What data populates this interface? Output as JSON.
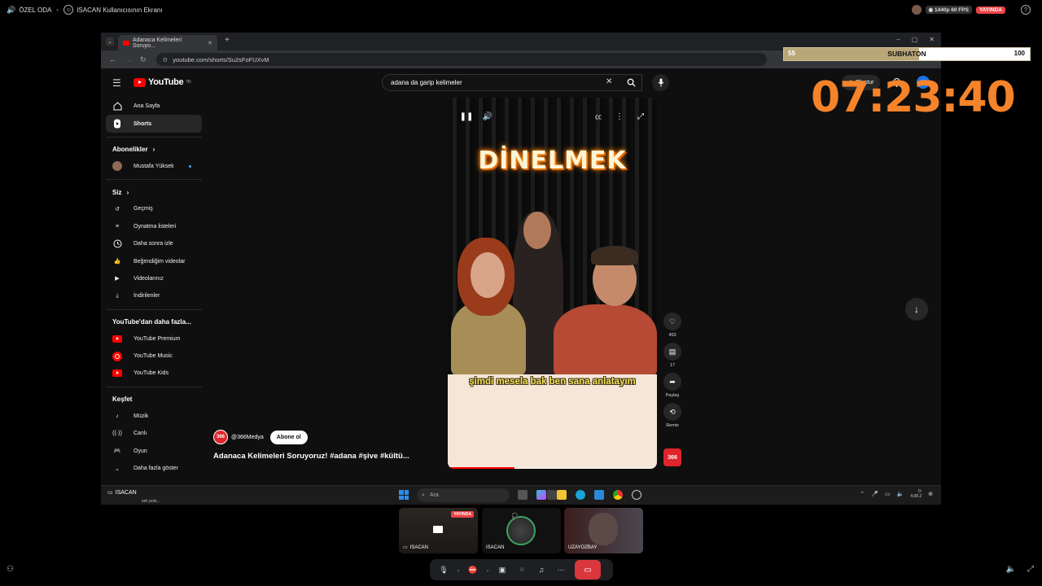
{
  "discord": {
    "server_name": "ÖZEL ODA",
    "stream_title": "ISACAN Kullanıcısının Ekranı",
    "quality": "1440p 60 FPS",
    "live_badge": "YAYINDA"
  },
  "browser": {
    "tab_title": "Adanaca Kelimeleri Soruyo...",
    "url": "youtube.com/shorts/Su2sFoFUXvM"
  },
  "youtube": {
    "logo_text": "YouTube",
    "logo_region": "TR",
    "search_value": "adana da garip kelimeler",
    "create_label": "Oluştur",
    "avatar_letter": "H",
    "sidebar": {
      "home": "Ana Sayfa",
      "shorts": "Shorts",
      "subscriptions_header": "Abonelikler",
      "subscription_1": "Mustafa Yüksek",
      "you_header": "Siz",
      "history": "Geçmiş",
      "playlists": "Oynatma listeleri",
      "watch_later": "Daha sonra izle",
      "liked": "Beğendiğim videolar",
      "your_videos": "Videolarınız",
      "downloads": "İndirilenler",
      "more_header": "YouTube'dan daha fazla...",
      "premium": "YouTube Premium",
      "music": "YouTube Music",
      "kids": "YouTube Kids",
      "explore_header": "Keşfet",
      "explore_music": "Müzik",
      "explore_live": "Canlı",
      "explore_gaming": "Oyun",
      "show_more": "Daha fazla göster"
    },
    "short": {
      "overlay_title": "DİNELMEK",
      "caption": "şimdi mesela bak ben sana anlatayım",
      "progress": 0.32,
      "likes": "453",
      "comments": "17",
      "share_label": "Paylaş",
      "remix_label": "Remix",
      "channel": "@366Medya",
      "channel_logo": "366",
      "subscribe_label": "Abone ol",
      "title": "Adanaca Kelimeleri Soruyoruz! #adana #şive #kültü..."
    }
  },
  "taskbar": {
    "search_placeholder": "Ara",
    "overlay_user": "ISACAN",
    "overlay_sub": "sek pole...",
    "clock_time": "0:",
    "clock_date": "4.08.2"
  },
  "subathon": {
    "left_value": "55",
    "label": "SUBHATON",
    "right_value": "100",
    "progress": 0.55,
    "timer": "07:23:40"
  },
  "participants": [
    {
      "name": "ISACAN",
      "live": "YAYINDA"
    },
    {
      "name": "ISACAN"
    },
    {
      "name": "UZAYOZBAY"
    }
  ],
  "colors": {
    "accent_orange": "#f5832a",
    "youtube_red": "#ff0000",
    "discord_red": "#da373c"
  }
}
